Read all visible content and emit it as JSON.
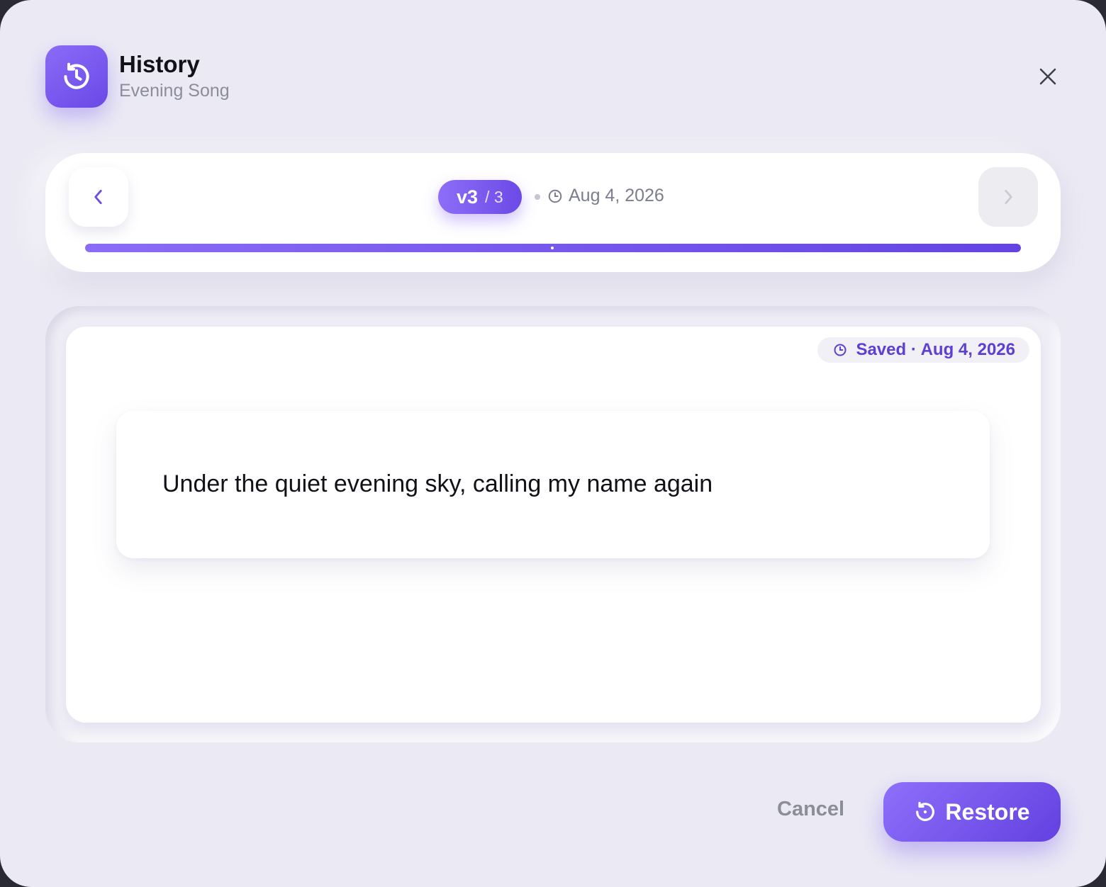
{
  "header": {
    "title": "History",
    "subtitle": "Evening Song",
    "icon": "history-icon",
    "close_icon": "close-icon"
  },
  "navigator": {
    "prev_icon": "chevron-left-icon",
    "next_icon": "chevron-right-icon",
    "current_version": "v3",
    "total_label": "/ 3",
    "date": "Aug 4, 2026",
    "progress": 1.0
  },
  "content": {
    "saved_label": "Saved · Aug 4, 2026",
    "lyric": "Under the quiet evening sky, calling my name again"
  },
  "footer": {
    "cancel_label": "Cancel",
    "restore_label": "Restore",
    "restore_icon": "restore-icon"
  },
  "colors": {
    "accent": "#7654f0",
    "accent_dark": "#5d3fd6",
    "background": "#ebeaf4",
    "muted_text": "#8b8d9c"
  }
}
